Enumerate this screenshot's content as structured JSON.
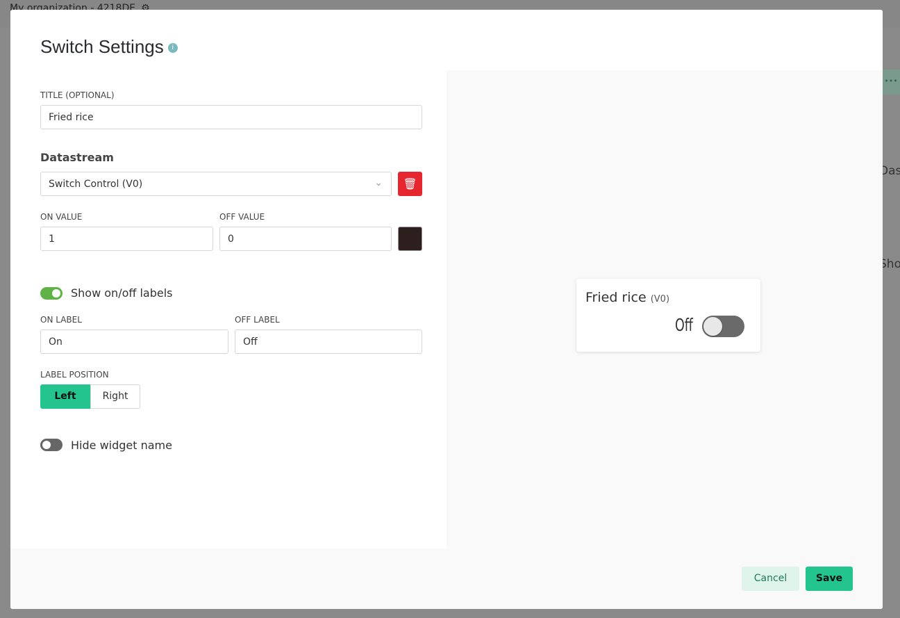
{
  "background": {
    "org": "My organization - 4218DE",
    "partial_text_1": "Dash",
    "partial_text_2": "Show"
  },
  "modal": {
    "title": "Switch Settings",
    "title_field": {
      "label": "TITLE (OPTIONAL)",
      "value": "Fried rice"
    },
    "datastream": {
      "heading": "Datastream",
      "value": "Switch Control (V0)"
    },
    "on_value": {
      "label": "ON VALUE",
      "value": "1"
    },
    "off_value": {
      "label": "OFF VALUE",
      "value": "0"
    },
    "widget_color": "#2e1f1f",
    "show_labels": {
      "label": "Show on/off labels",
      "on": true
    },
    "on_label": {
      "label": "ON LABEL",
      "value": "On"
    },
    "off_label": {
      "label": "OFF LABEL",
      "value": "Off"
    },
    "label_position": {
      "label": "LABEL POSITION",
      "options": [
        "Left",
        "Right"
      ],
      "selected": "Left"
    },
    "hide_name": {
      "label": "Hide widget name",
      "on": false
    },
    "preview": {
      "title": "Fried rice",
      "pin": "(V0)",
      "state_label": "Off",
      "on": false
    },
    "cancel": "Cancel",
    "save": "Save"
  },
  "colors": {
    "accent": "#23c48e",
    "danger": "#e5262f"
  }
}
